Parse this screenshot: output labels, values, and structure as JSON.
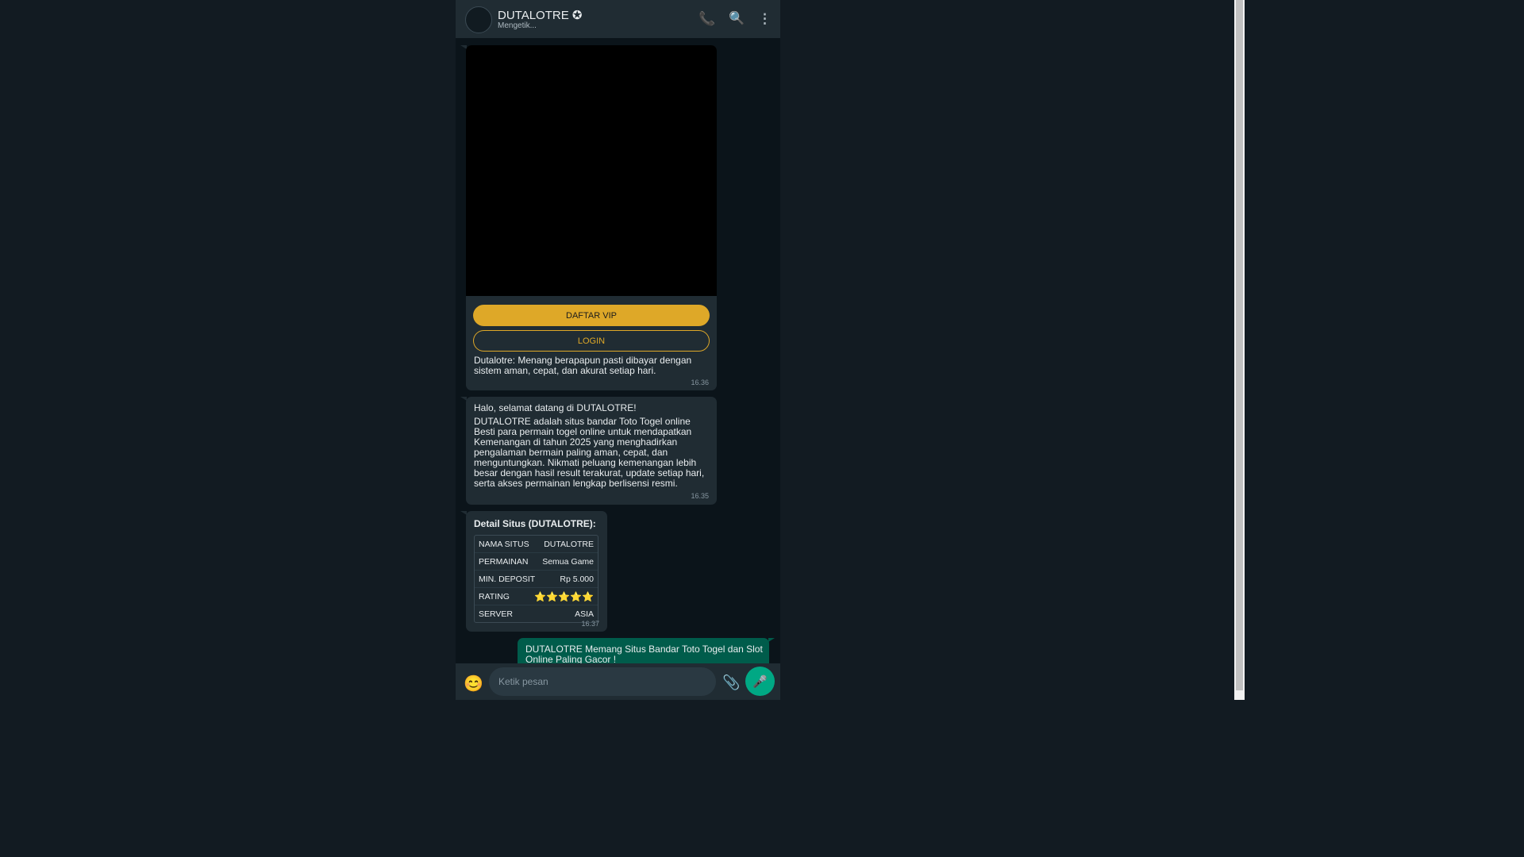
{
  "header": {
    "title": "DUTALOTRE ✪",
    "status": "Mengetik...",
    "icons": [
      "phone-icon",
      "search-icon",
      "more-vertical-icon"
    ]
  },
  "messages": {
    "promo": {
      "vip_button": "DAFTAR VIP",
      "login_button": "LOGIN",
      "caption": "Dutalotre: Menang berapapun pasti dibayar dengan sistem aman, cepat, dan akurat setiap hari.",
      "time": "16.36"
    },
    "welcome": {
      "greeting": "Halo, selamat datang di DUTALOTRE!",
      "body": "DUTALOTRE adalah situs bandar Toto Togel online Besti para permain togel online untuk mendapatkan Kemenangan di tahun 2025 yang menghadirkan pengalaman bermain paling aman, cepat, dan menguntungkan. Nikmati peluang kemenangan lebih besar dengan hasil result terakurat, update setiap hari, serta akses permainan lengkap berlisensi resmi.",
      "time": "16.35"
    },
    "details": {
      "title": "Detail Situs (DUTALOTRE):",
      "rows": [
        {
          "label": "NAMA SITUS",
          "value": "DUTALOTRE"
        },
        {
          "label": "PERMAINAN",
          "value": "Semua Game"
        },
        {
          "label": "MIN. DEPOSIT",
          "value": "Rp 5.000"
        },
        {
          "label": "RATING",
          "value": "⭐⭐⭐⭐⭐"
        },
        {
          "label": "SERVER",
          "value": "ASIA"
        }
      ],
      "rating_stars": 5,
      "time": "16.37"
    },
    "outgoing": {
      "text": "DUTALOTRE Memang Situs Bandar Toto Togel dan Slot Online Paling Gacor !"
    }
  },
  "footer": {
    "placeholder": "Ketik pesan",
    "emoji": "😊",
    "attach": "📎",
    "mic": "🎤"
  },
  "colors": {
    "accent_gold": "#dea828",
    "header_bg": "#202c33",
    "chat_bg": "#0b141a",
    "outgoing_bubble": "#005c4b",
    "send_button": "#00a884"
  }
}
